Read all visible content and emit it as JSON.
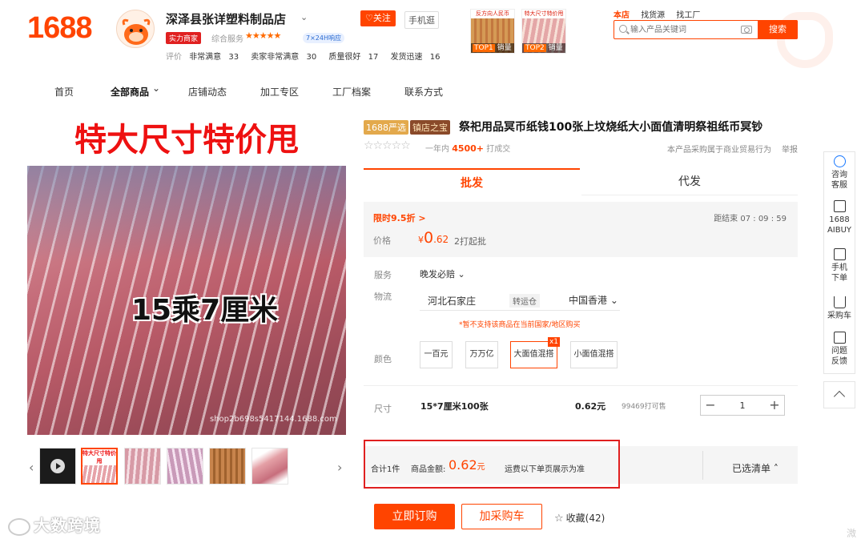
{
  "header": {
    "logo": "1688",
    "shop_name": "深泽县张详塑料制品店",
    "follow": "♡关注",
    "mobile_shop": "手机逛",
    "strength_badge": "实力商家",
    "service_label": "综合服务",
    "service_stars": "★★★★★",
    "response_badge": "7×24H响应",
    "ratings_label": "评价",
    "ratings": [
      {
        "label": "非常满意",
        "count": "33"
      },
      {
        "label": "卖家非常满意",
        "count": "30"
      },
      {
        "label": "质量很好",
        "count": "17"
      },
      {
        "label": "发货迅速",
        "count": "16"
      }
    ],
    "top_products": [
      {
        "caption": "反方向人民币",
        "rank": "TOP1",
        "label": "销量"
      },
      {
        "caption": "特大尺寸特价甩",
        "rank": "TOP2",
        "label": "销量"
      }
    ]
  },
  "search": {
    "tabs": [
      "本店",
      "找货源",
      "找工厂"
    ],
    "placeholder": "输入产品关键词",
    "button": "搜索"
  },
  "nav": {
    "items": [
      "首页",
      "全部商品",
      "店铺动态",
      "加工专区",
      "工厂档案",
      "联系方式"
    ],
    "caret": "⌄"
  },
  "gallery": {
    "banner": "特大尺寸特价甩",
    "size_text": "15乘7厘米",
    "watermark": "shop2b698s5417144.1688.com",
    "thumbs_caption": "特大尺寸特价甩"
  },
  "product": {
    "tag_yan": "1688严选",
    "tag_zhen": "镇店之宝",
    "title": "祭祀用品冥币纸钱100张上坟烧纸大小面值清明祭祖纸币冥钞",
    "rating_stars": "☆☆☆☆☆",
    "sold_prefix": "一年内",
    "sold_count": "4500+",
    "sold_suffix": "打成交",
    "trade_note": "本产品采购属于商业贸易行为",
    "report": "举报"
  },
  "tabs": {
    "wholesale": "批发",
    "dropship": "代发"
  },
  "price": {
    "flash_sale": "限时9.5折 >",
    "countdown": "距结束  07 : 09 : 59",
    "label": "价格",
    "currency": "¥",
    "int_part": "0",
    "dec_part": ".62",
    "min_order": "2打起批"
  },
  "service": {
    "label": "服务",
    "value": "晚发必赔 ⌄"
  },
  "logistics": {
    "label": "物流",
    "from": "河北石家庄",
    "transfer": "转运仓",
    "to": "中国香港 ⌄",
    "warning": "*暂不支持该商品在当前国家/地区购买"
  },
  "color": {
    "label": "颜色",
    "options": [
      "一百元",
      "万万亿",
      "大面值混搭",
      "小面值混搭"
    ],
    "selected_badge": "x1"
  },
  "size": {
    "label": "尺寸",
    "name": "15*7厘米100张",
    "price": "0.62元",
    "stock": "99469打可售",
    "minus": "−",
    "plus": "+",
    "quantity": "1"
  },
  "summary": {
    "count": "合计1件",
    "amount_label": "商品金额:",
    "amount": "0.62",
    "unit": "元",
    "freight": "运费以下单页展示为准",
    "selected_list": "已选清单 ˄"
  },
  "actions": {
    "buy_now": "立即订购",
    "add_cart": "加采购车",
    "favorite_icon": "☆",
    "favorite": "收藏(42)"
  },
  "sidebar": {
    "items": [
      {
        "line1": "咨询",
        "line2": "客服"
      },
      {
        "line1": "1688",
        "line2": "AIBUY"
      },
      {
        "line1": "手机",
        "line2": "下单"
      },
      {
        "line1": "采购车",
        "line2": ""
      },
      {
        "line1": "问题",
        "line2": "反馈"
      }
    ]
  },
  "watermark_brand": "大数跨境",
  "corner_text": "溦"
}
